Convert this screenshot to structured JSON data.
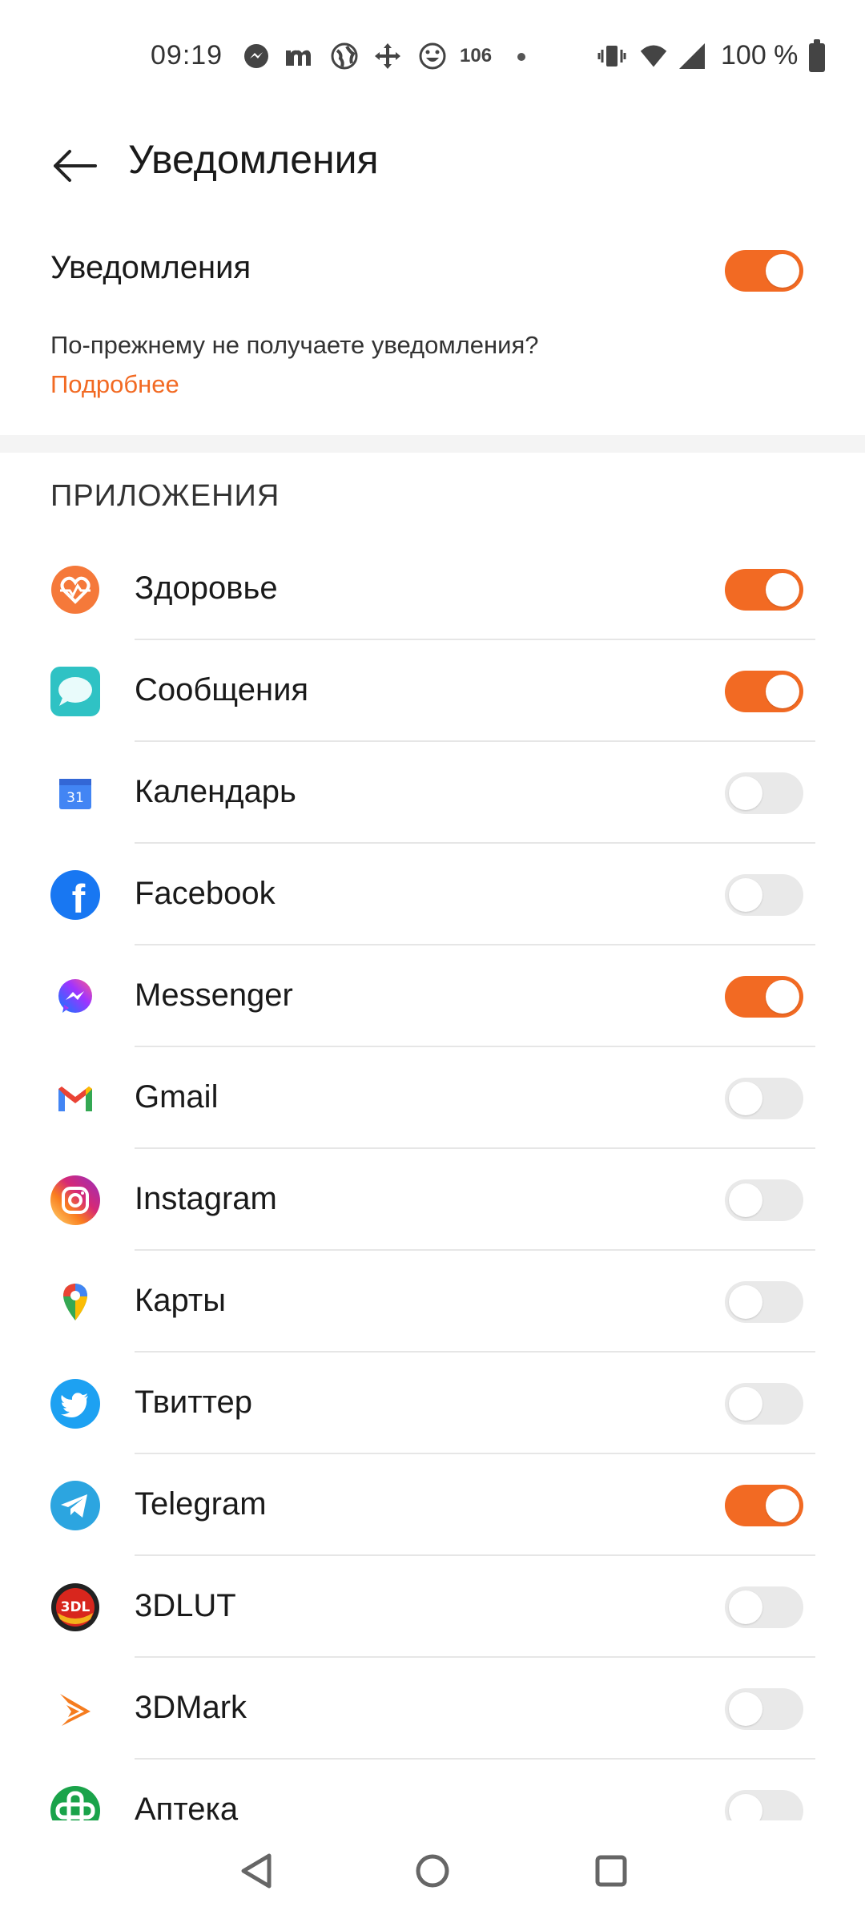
{
  "status_bar": {
    "time": "09:19",
    "badge": "106",
    "battery": "100 %",
    "icons": [
      "messenger-icon",
      "m-icon",
      "globe-icon",
      "move-icon",
      "emoji-icon",
      "vibrate-icon",
      "wifi-icon",
      "signal-icon",
      "battery-icon"
    ]
  },
  "header": {
    "title": "Уведомления"
  },
  "master": {
    "label": "Уведомления",
    "enabled": true
  },
  "hint": {
    "text": "По-прежнему не получаете уведомления?",
    "link": "Подробнее"
  },
  "section": {
    "title": "ПРИЛОЖЕНИЯ"
  },
  "apps": [
    {
      "name": "Здоровье",
      "enabled": true,
      "icon": "health-icon"
    },
    {
      "name": "Сообщения",
      "enabled": true,
      "icon": "messages-icon"
    },
    {
      "name": "Календарь",
      "enabled": false,
      "icon": "calendar-icon",
      "icon_text": "31"
    },
    {
      "name": "Facebook",
      "enabled": false,
      "icon": "facebook-icon",
      "icon_text": "f"
    },
    {
      "name": "Messenger",
      "enabled": true,
      "icon": "messenger-icon"
    },
    {
      "name": "Gmail",
      "enabled": false,
      "icon": "gmail-icon"
    },
    {
      "name": "Instagram",
      "enabled": false,
      "icon": "instagram-icon"
    },
    {
      "name": "Карты",
      "enabled": false,
      "icon": "maps-icon"
    },
    {
      "name": "Твиттер",
      "enabled": false,
      "icon": "twitter-icon"
    },
    {
      "name": "Telegram",
      "enabled": true,
      "icon": "telegram-icon"
    },
    {
      "name": "3DLUT",
      "enabled": false,
      "icon": "3dlut-icon",
      "icon_text": "3DL"
    },
    {
      "name": "3DMark",
      "enabled": false,
      "icon": "3dmark-icon"
    },
    {
      "name": "Аптека",
      "enabled": false,
      "icon": "pharmacy-icon"
    }
  ],
  "colors": {
    "accent": "#f26a23",
    "toggle_off": "#e9e9e9"
  }
}
